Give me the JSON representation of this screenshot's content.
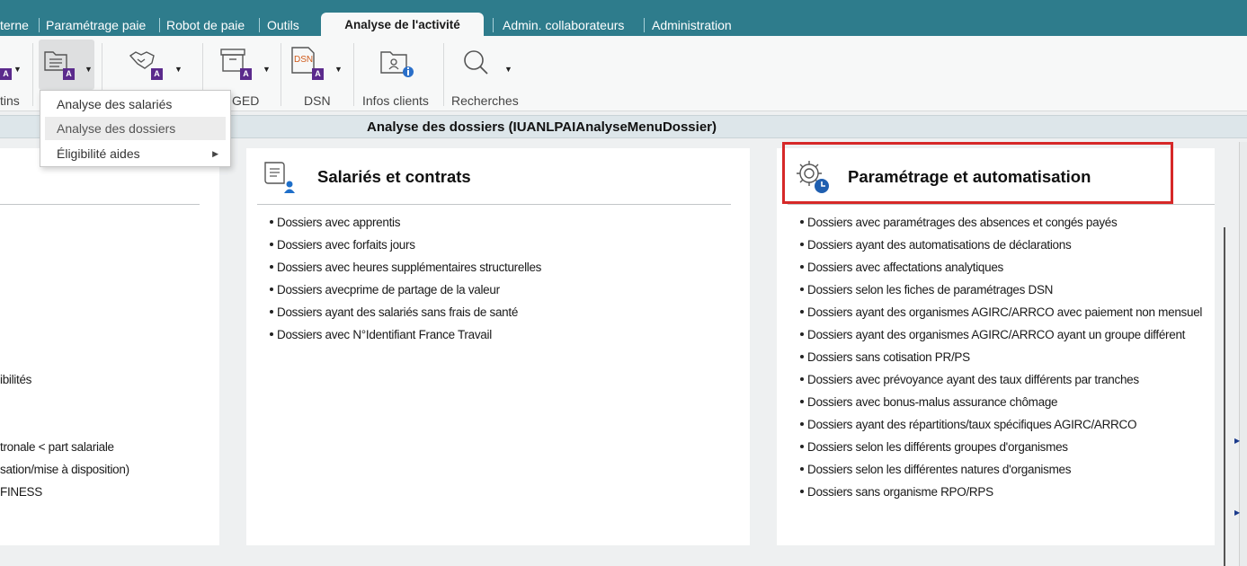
{
  "tabs": [
    {
      "label": "terne"
    },
    {
      "label": "Paramétrage paie"
    },
    {
      "label": "Robot de paie"
    },
    {
      "label": "Outils"
    },
    {
      "label": "Analyse de l'activité"
    },
    {
      "label": "Admin. collaborateurs"
    },
    {
      "label": "Administration"
    }
  ],
  "ribbon": {
    "labels": {
      "bulletins": "tins",
      "ged": "GED",
      "dsn": "DSN",
      "infos_clients": "Infos clients",
      "recherches": "Recherches"
    },
    "badge_letter": "A",
    "dsn_icon_text": "DSN"
  },
  "menu": {
    "items": [
      {
        "label": "Analyse des salariés"
      },
      {
        "label": "Analyse des dossiers"
      },
      {
        "label": "Éligibilité aides"
      }
    ]
  },
  "title_bar": "Analyse des dossiers (IUANLPAIAnalyseMenuDossier)",
  "left_panel": {
    "items": [
      "ibilités",
      "tronale < part salariale",
      "sation/mise à disposition)",
      "FINESS"
    ]
  },
  "middle_panel": {
    "title": "Salariés et contrats",
    "items": [
      "Dossiers avec apprentis",
      "Dossiers avec forfaits jours",
      "Dossiers avec heures supplémentaires structurelles",
      "Dossiers avecprime de partage de la valeur",
      "Dossiers ayant des salariés sans frais de santé",
      "Dossiers avec N°Identifiant France Travail"
    ]
  },
  "right_panel": {
    "title": "Paramétrage et automatisation",
    "items": [
      "Dossiers avec paramétrages des absences et congés payés",
      "Dossiers ayant des automatisations de déclarations",
      "Dossiers avec affectations analytiques",
      "Dossiers selon les fiches de paramétrages DSN",
      "Dossiers ayant des organismes AGIRC/ARRCO avec paiement non mensuel",
      "Dossiers ayant des organismes AGIRC/ARRCO ayant un groupe différent",
      "Dossiers sans cotisation PR/PS",
      "Dossiers avec prévoyance ayant des taux différents par tranches",
      "Dossiers avec bonus-malus assurance chômage",
      "Dossiers ayant des répartitions/taux spécifiques AGIRC/ARRCO",
      "Dossiers selon les différents groupes d'organismes",
      "Dossiers selon les différentes natures d'organismes",
      "Dossiers sans organisme RPO/RPS"
    ]
  },
  "colors": {
    "tab_bar": "#2e7c8c",
    "badge": "#5b2a8c",
    "highlight": "#d62828",
    "info_icon": "#2a6fc9"
  }
}
